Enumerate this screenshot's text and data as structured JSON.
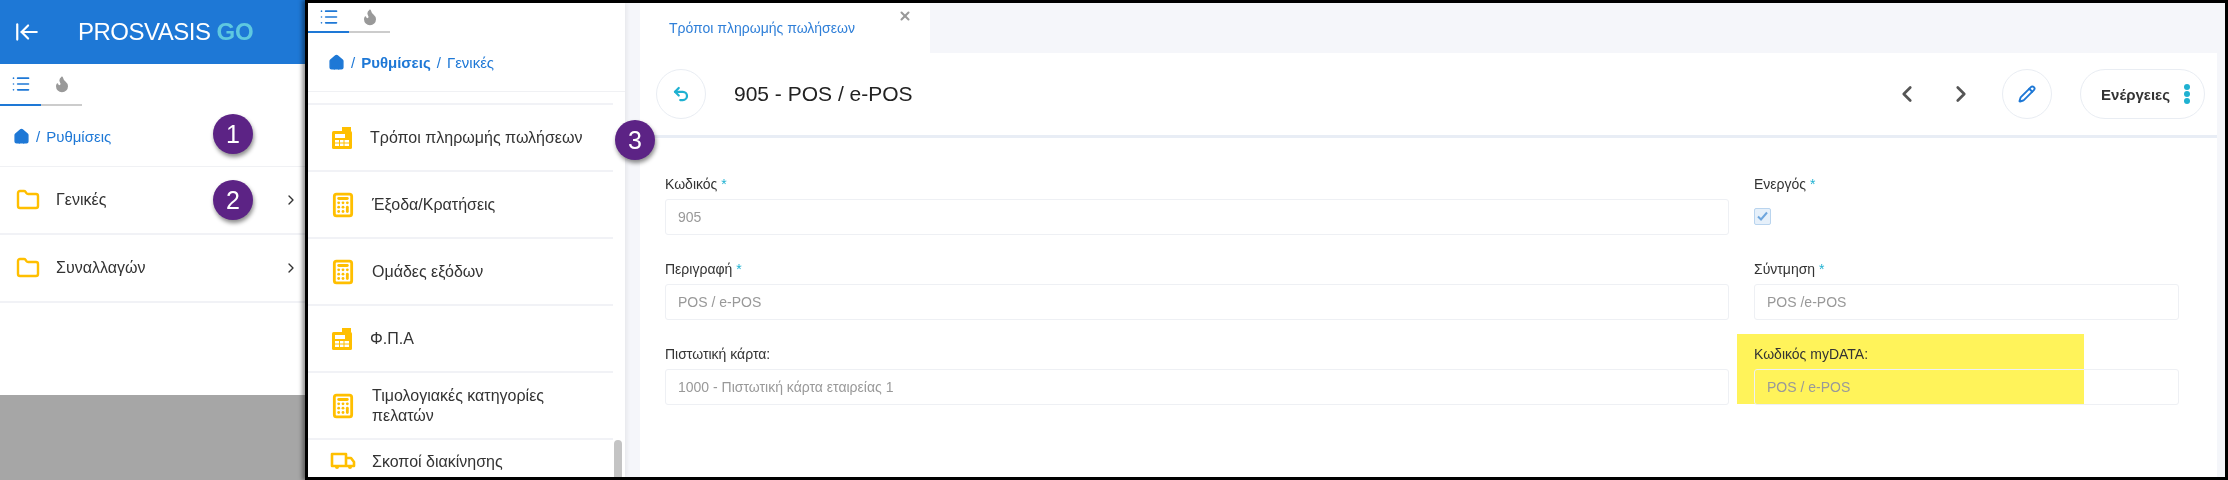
{
  "left_panel": {
    "brand": {
      "name": "PROSVASIS",
      "suffix": "GO"
    },
    "tabs": [
      {
        "kind": "list",
        "selected": true
      },
      {
        "kind": "fire",
        "selected": false
      }
    ],
    "breadcrumb": [
      {
        "separator": "/",
        "label": "Ρυθμίσεις",
        "bold": false
      }
    ],
    "items": [
      {
        "label": "Γενικές"
      },
      {
        "label": "Συναλλαγών"
      }
    ]
  },
  "sidebar": {
    "tabs": [
      {
        "kind": "list",
        "selected": true
      },
      {
        "kind": "fire",
        "selected": false
      }
    ],
    "breadcrumb": [
      {
        "separator": "/",
        "label": "Ρυθμίσεις",
        "bold": true
      },
      {
        "separator": "/",
        "label": "Γενικές",
        "bold": false
      }
    ],
    "items": [
      {
        "label": "Τρόποι πληρωμής πωλήσεων",
        "kind": "register"
      },
      {
        "label": "Έξοδα/Κρατήσεις",
        "kind": "calculator"
      },
      {
        "label": "Ομάδες εξόδων",
        "kind": "calculator"
      },
      {
        "label": "Φ.Π.Α",
        "kind": "register"
      },
      {
        "label": "Τιμολογιακές κατηγορίες πελατών",
        "kind": "calculator"
      },
      {
        "label": "Σκοποί διακίνησης",
        "kind": "truck"
      }
    ]
  },
  "document_tab": {
    "label": "Τρόποι πληρωμής πωλήσεων",
    "selected": true
  },
  "record": {
    "title": "905 - POS / e-POS",
    "actions_label": "Ενέργειες"
  },
  "form_rows": [
    [
      {
        "kind": "text",
        "label": "Κωδικός",
        "required": true,
        "required_mark": "*",
        "value": "905",
        "highlighted": false
      },
      {
        "kind": "checkbox",
        "label": "Ενεργός",
        "required": true,
        "required_mark": "*",
        "checked": true,
        "highlighted": false
      }
    ],
    [
      {
        "kind": "text",
        "label": "Περιγραφή",
        "required": true,
        "required_mark": "*",
        "value": "POS / e-POS",
        "highlighted": false
      },
      {
        "kind": "text",
        "label": "Σύντμηση",
        "required": true,
        "required_mark": "*",
        "value": "POS /e-POS",
        "highlighted": false
      }
    ],
    [
      {
        "kind": "text",
        "label": "Πιστωτική κάρτα:",
        "required": false,
        "value": "1000 - Πιστωτική κάρτα εταιρείας 1",
        "highlighted": false
      },
      {
        "kind": "text",
        "label": "Κωδικός myDATA:",
        "required": false,
        "value": "POS / e-POS",
        "highlighted": true
      }
    ]
  ],
  "markers": [
    {
      "number": "1"
    },
    {
      "number": "2"
    },
    {
      "number": "3"
    }
  ]
}
